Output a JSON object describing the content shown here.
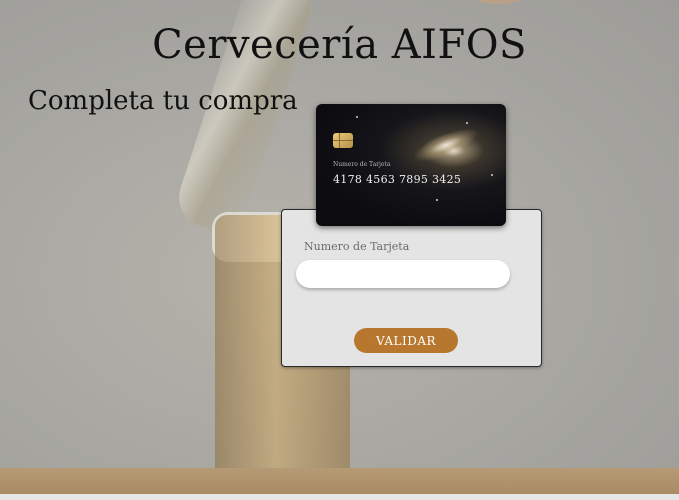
{
  "header": {
    "title": "Cervecería AIFOS",
    "subtitle": "Completa tu compra"
  },
  "card": {
    "label": "Numero de Tarjeta",
    "number": "4178 4563 7895 3425"
  },
  "form": {
    "label": "Numero de Tarjeta",
    "input_value": "",
    "validate_label": "VALIDAR"
  },
  "colors": {
    "accent": "#b8772e",
    "background": "#a9a9a5",
    "form_bg": "#e4e4e4"
  }
}
